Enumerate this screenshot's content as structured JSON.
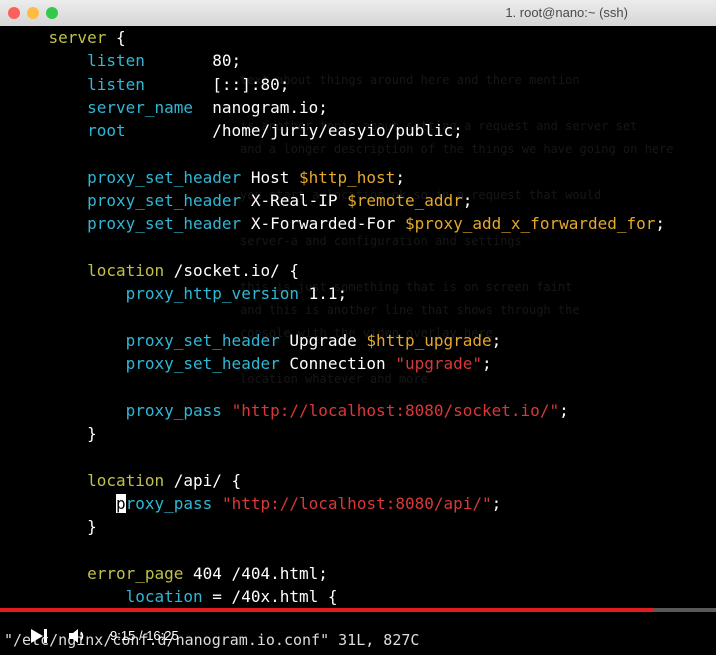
{
  "window": {
    "title": "1. root@nano:~ (ssh)"
  },
  "code_lines": [
    [
      {
        "t": "    ",
        "c": ""
      },
      {
        "t": "server",
        "c": "kw"
      },
      {
        "t": " {",
        "c": ""
      }
    ],
    [
      {
        "t": "        ",
        "c": ""
      },
      {
        "t": "listen",
        "c": "dir"
      },
      {
        "t": "       80;",
        "c": ""
      }
    ],
    [
      {
        "t": "        ",
        "c": ""
      },
      {
        "t": "listen",
        "c": "dir"
      },
      {
        "t": "       [::]:80;",
        "c": ""
      }
    ],
    [
      {
        "t": "        ",
        "c": ""
      },
      {
        "t": "server_name",
        "c": "dir"
      },
      {
        "t": "  nanogram.io;",
        "c": ""
      }
    ],
    [
      {
        "t": "        ",
        "c": ""
      },
      {
        "t": "root",
        "c": "dir"
      },
      {
        "t": "         /home/juriy/easyio/public;",
        "c": ""
      }
    ],
    [],
    [
      {
        "t": "        ",
        "c": ""
      },
      {
        "t": "proxy_set_header",
        "c": "dir"
      },
      {
        "t": " Host ",
        "c": ""
      },
      {
        "t": "$http_host",
        "c": "var"
      },
      {
        "t": ";",
        "c": ""
      }
    ],
    [
      {
        "t": "        ",
        "c": ""
      },
      {
        "t": "proxy_set_header",
        "c": "dir"
      },
      {
        "t": " X-Real-IP ",
        "c": ""
      },
      {
        "t": "$remote_addr",
        "c": "var"
      },
      {
        "t": ";",
        "c": ""
      }
    ],
    [
      {
        "t": "        ",
        "c": ""
      },
      {
        "t": "proxy_set_header",
        "c": "dir"
      },
      {
        "t": " X-Forwarded-For ",
        "c": ""
      },
      {
        "t": "$proxy_add_x_forwarded_for",
        "c": "var"
      },
      {
        "t": ";",
        "c": ""
      }
    ],
    [],
    [
      {
        "t": "        ",
        "c": ""
      },
      {
        "t": "location",
        "c": "kw"
      },
      {
        "t": " /socket.io/ {",
        "c": ""
      }
    ],
    [
      {
        "t": "            ",
        "c": ""
      },
      {
        "t": "proxy_http_version",
        "c": "dir"
      },
      {
        "t": " 1.1;",
        "c": ""
      }
    ],
    [],
    [
      {
        "t": "            ",
        "c": ""
      },
      {
        "t": "proxy_set_header",
        "c": "dir"
      },
      {
        "t": " Upgrade ",
        "c": ""
      },
      {
        "t": "$http_upgrade",
        "c": "var"
      },
      {
        "t": ";",
        "c": ""
      }
    ],
    [
      {
        "t": "            ",
        "c": ""
      },
      {
        "t": "proxy_set_header",
        "c": "dir"
      },
      {
        "t": " Connection ",
        "c": ""
      },
      {
        "t": "\"upgrade\"",
        "c": "str"
      },
      {
        "t": ";",
        "c": ""
      }
    ],
    [],
    [
      {
        "t": "            ",
        "c": ""
      },
      {
        "t": "proxy_pass",
        "c": "dir"
      },
      {
        "t": " ",
        "c": ""
      },
      {
        "t": "\"http://localhost:8080/socket.io/\"",
        "c": "str"
      },
      {
        "t": ";",
        "c": ""
      }
    ],
    [
      {
        "t": "        }",
        "c": ""
      }
    ],
    [],
    [
      {
        "t": "        ",
        "c": ""
      },
      {
        "t": "location",
        "c": "kw"
      },
      {
        "t": " /api/ {",
        "c": ""
      }
    ],
    [
      {
        "t": "           ",
        "c": ""
      },
      {
        "t": "p",
        "c": "cursor"
      },
      {
        "t": "roxy_pass",
        "c": "dir"
      },
      {
        "t": " ",
        "c": ""
      },
      {
        "t": "\"http://localhost:8080/api/\"",
        "c": "str"
      },
      {
        "t": ";",
        "c": ""
      }
    ],
    [
      {
        "t": "        }",
        "c": ""
      }
    ],
    [],
    [
      {
        "t": "        ",
        "c": ""
      },
      {
        "t": "error_page",
        "c": "kw"
      },
      {
        "t": " 404 /404.html;",
        "c": ""
      }
    ],
    [
      {
        "t": "            ",
        "c": ""
      },
      {
        "t": "location",
        "c": "dir"
      },
      {
        "t": " = /40x.html {",
        "c": ""
      }
    ]
  ],
  "status_line": "\"/etc/nginx/conf.d/nanogram.io.conf\" 31L, 827C",
  "player": {
    "current_time": "9:15",
    "duration": "16:25",
    "progress": 0.913
  },
  "colors": {
    "keyword": "#c1c14a",
    "directive": "#2fb8d6",
    "variable": "#e5a82b",
    "string": "#d73939",
    "progress": "#e01d1d"
  }
}
